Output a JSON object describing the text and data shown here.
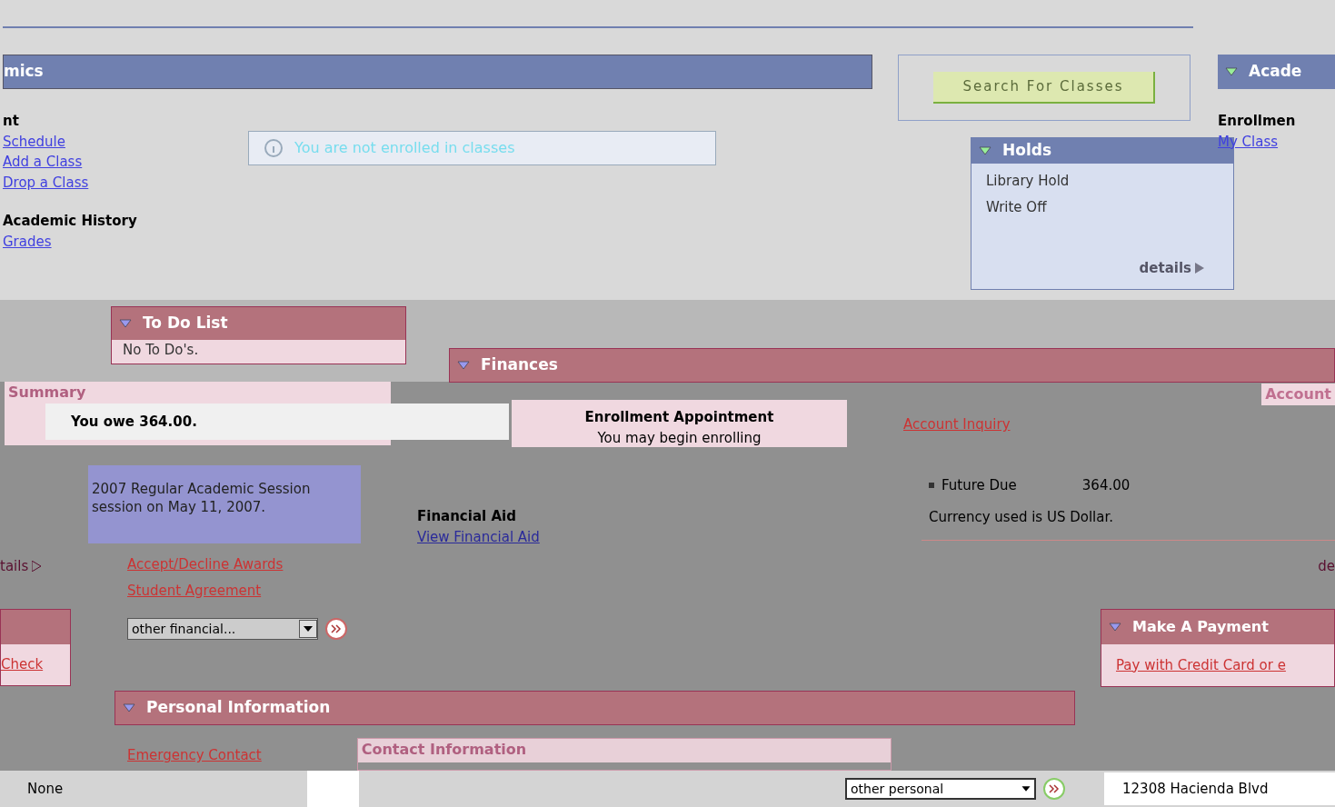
{
  "academics": {
    "header": "mics",
    "section_label": "nt",
    "links": [
      "Schedule",
      "Add a Class",
      "Drop a Class"
    ],
    "history_label": "Academic History",
    "history_links": [
      "Grades"
    ],
    "notice": "You are not enrolled in classes"
  },
  "search_button": "Search For Classes",
  "holds": {
    "title": "Holds",
    "items": [
      "Library Hold",
      "Write Off"
    ],
    "details": "details"
  },
  "right_panel": {
    "title": "Acade",
    "label": "Enrollmen",
    "link": "My Class"
  },
  "todo": {
    "title": "To Do List",
    "text": "No To Do's."
  },
  "finances": {
    "title": "Finances",
    "summary": "Summary",
    "owe": "You owe 364.00.",
    "account_inquiry": "Account Inquiry",
    "account_tab": "Account",
    "future_due_label": "Future Due",
    "future_due_amount": "364.00",
    "currency": "Currency used is US Dollar.",
    "details": "tails",
    "financial_aid": "Financial Aid",
    "view_financial_aid": "View Financial Aid",
    "links": [
      "Accept/Decline Awards",
      "Student Agreement"
    ],
    "dropdown": "other financial...",
    "right_details": "de"
  },
  "enrollment_appointment": {
    "title": "Enrollment Appointment",
    "text": "You may begin enrolling",
    "session": "2007 Regular Academic Session session on May 11, 2007."
  },
  "check_link": "Check",
  "make_payment": {
    "title": "Make A Payment",
    "link": "Pay with Credit Card or e"
  },
  "personal": {
    "title": "Personal Information",
    "link": "Emergency Contact",
    "contact_title": "Contact Information",
    "none": "None",
    "dropdown": "other personal",
    "address": "12308 Hacienda Blvd"
  }
}
